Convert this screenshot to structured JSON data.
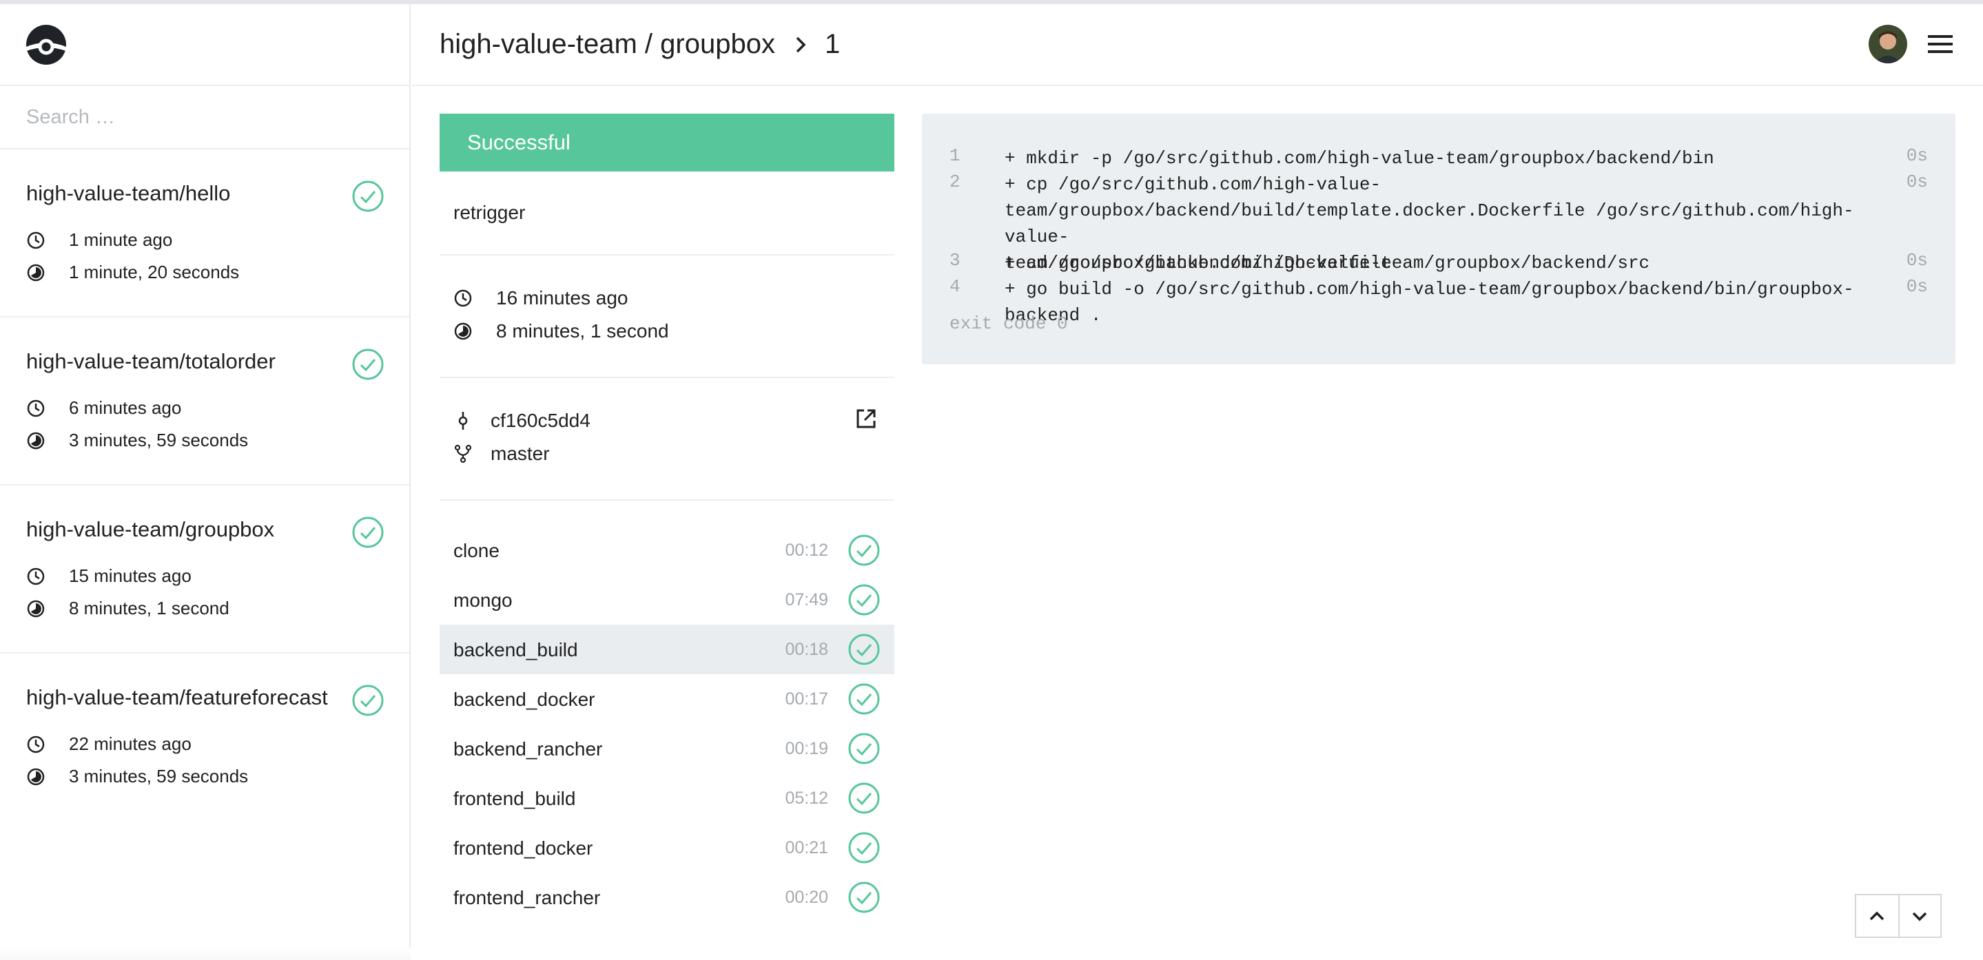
{
  "colors": {
    "success": "#57c79b",
    "muted": "#a5a9ae",
    "border": "#eceef0",
    "log_bg": "#eceff1"
  },
  "sidebar": {
    "logo_icon": "drone-logo-icon",
    "search": {
      "placeholder": "Search …",
      "value": ""
    },
    "repos": [
      {
        "name": "high-value-team/hello",
        "started": "1 minute ago",
        "duration": "1 minute, 20 seconds",
        "status": "success"
      },
      {
        "name": "high-value-team/totalorder",
        "started": "6 minutes ago",
        "duration": "3 minutes, 59 seconds",
        "status": "success"
      },
      {
        "name": "high-value-team/groupbox",
        "started": "15 minutes ago",
        "duration": "8 minutes, 1 second",
        "status": "success"
      },
      {
        "name": "high-value-team/featureforecast",
        "started": "22 minutes ago",
        "duration": "3 minutes, 59 seconds",
        "status": "success"
      }
    ]
  },
  "header": {
    "repo": "high-value-team / groupbox",
    "build_number": "1",
    "avatar_icon": "user-avatar",
    "menu_icon": "hamburger-menu-icon"
  },
  "build": {
    "status": "Successful",
    "retrigger_label": "retrigger",
    "started": "16 minutes ago",
    "duration": "8 minutes, 1 second",
    "commit": "cf160c5dd4",
    "branch": "master",
    "steps": [
      {
        "name": "clone",
        "time": "00:12",
        "status": "success"
      },
      {
        "name": "mongo",
        "time": "07:49",
        "status": "success"
      },
      {
        "name": "backend_build",
        "time": "00:18",
        "status": "success",
        "active": true
      },
      {
        "name": "backend_docker",
        "time": "00:17",
        "status": "success"
      },
      {
        "name": "backend_rancher",
        "time": "00:19",
        "status": "success"
      },
      {
        "name": "frontend_build",
        "time": "05:12",
        "status": "success"
      },
      {
        "name": "frontend_docker",
        "time": "00:21",
        "status": "success"
      },
      {
        "name": "frontend_rancher",
        "time": "00:20",
        "status": "success"
      }
    ]
  },
  "log": {
    "lines": [
      {
        "num": "1",
        "text": "+ mkdir -p /go/src/github.com/high-value-team/groupbox/backend/bin",
        "dur": "0s"
      },
      {
        "num": "2",
        "text": "+ cp /go/src/github.com/high-value-\nteam/groupbox/backend/build/template.docker.Dockerfile /go/src/github.com/high-value-\nteam/groupbox/backend/bin/Dockerfile",
        "dur": "0s"
      },
      {
        "num": "3",
        "text": "+ cd /go/src/github.com/high-value-team/groupbox/backend/src",
        "dur": "0s"
      },
      {
        "num": "4",
        "text": "+ go build -o /go/src/github.com/high-value-team/groupbox/backend/bin/groupbox-backend .",
        "dur": "0s"
      }
    ],
    "exit_code": "exit code 0"
  }
}
